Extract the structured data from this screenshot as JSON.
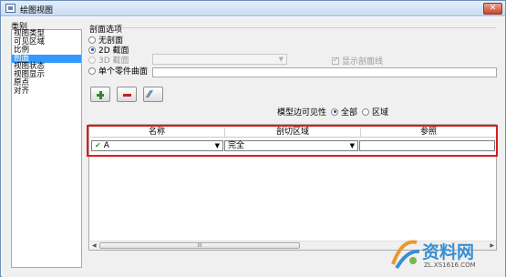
{
  "window": {
    "title": "绘图视图",
    "close_glyph": "✕"
  },
  "categories": {
    "label": "类别",
    "items": [
      "视图类型",
      "可见区域",
      "比例",
      "剖面",
      "视图状态",
      "视图显示",
      "原点",
      "对齐"
    ],
    "selected_index": 3
  },
  "section": {
    "group_title": "剖面选项",
    "options": [
      {
        "label": "无剖面",
        "checked": false,
        "enabled": true
      },
      {
        "label": "2D 截面",
        "checked": true,
        "enabled": true
      },
      {
        "label": "3D 截面",
        "checked": false,
        "enabled": false
      },
      {
        "label": "单个零件曲面",
        "checked": false,
        "enabled": true
      }
    ],
    "show_section_lines_label": "显示剖面线",
    "show_section_lines_checked": true
  },
  "toolbar": {
    "add_icon": "plus-icon",
    "remove_icon": "minus-icon",
    "flip_icon": "flip-icon",
    "flip_glyph": "⁄⁄"
  },
  "visibility": {
    "label": "模型边可见性",
    "options": [
      {
        "label": "全部",
        "checked": true
      },
      {
        "label": "区域",
        "checked": false
      }
    ]
  },
  "table": {
    "columns": [
      "名称",
      "剖切区域",
      "参照"
    ],
    "rows": [
      {
        "name": "A",
        "area": "完全",
        "ref": ""
      }
    ],
    "scroll_thumb_glyph": "III"
  },
  "watermark": {
    "text": "资料网",
    "url": "ZL.XS1616.COM"
  },
  "colors": {
    "accent": "#3399ff",
    "highlight_frame": "#e01a1a"
  }
}
